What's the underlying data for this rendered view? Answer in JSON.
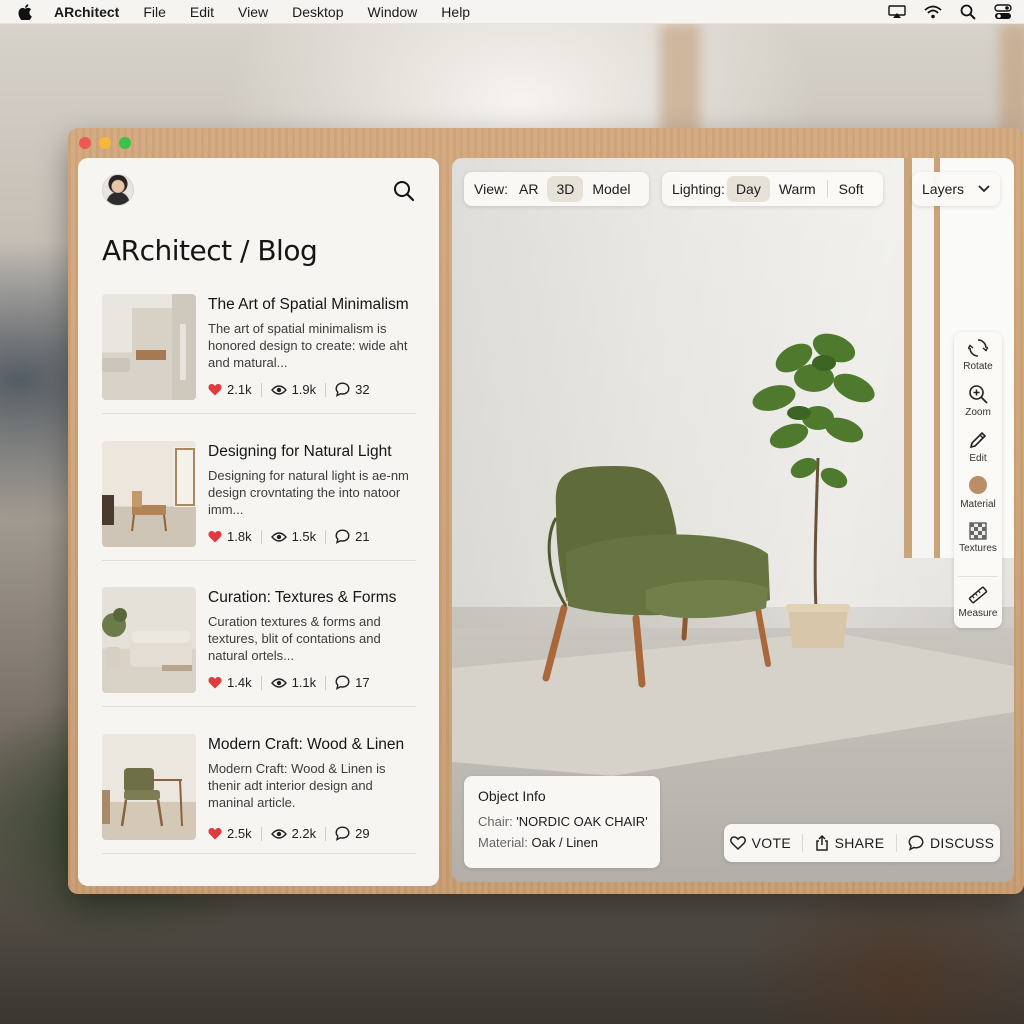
{
  "menubar": {
    "app_name": "ARchitect",
    "items": [
      "File",
      "Edit",
      "View",
      "Desktop",
      "Window",
      "Help"
    ]
  },
  "blog": {
    "title": "ARchitect / Blog",
    "posts": [
      {
        "title": "The Art of Spatial Minimalism",
        "excerpt": "The art of spatial minimalism is honored design to create: wide aht and matural...",
        "likes": "2.1k",
        "views": "1.9k",
        "comments": "32"
      },
      {
        "title": "Designing for Natural Light",
        "excerpt": "Designing for natural light is ae-nm design crovntating the into natoor imm...",
        "likes": "1.8k",
        "views": "1.5k",
        "comments": "21"
      },
      {
        "title": "Curation: Textures & Forms",
        "excerpt": "Curation textures & forms and textures, blit of contations and natural ortels...",
        "likes": "1.4k",
        "views": "1.1k",
        "comments": "17"
      },
      {
        "title": "Modern Craft: Wood & Linen",
        "excerpt": "Modern Craft: Wood & Linen is thenir adt interior design and maninal article.",
        "likes": "2.5k",
        "views": "2.2k",
        "comments": "29"
      }
    ]
  },
  "viewport": {
    "view": {
      "label": "View:",
      "options": [
        "AR",
        "3D",
        "Model"
      ],
      "selected": "3D"
    },
    "lighting": {
      "label": "Lighting:",
      "options": [
        "Day",
        "Warm",
        "Soft"
      ],
      "selected": "Day"
    },
    "layers_label": "Layers",
    "tools": [
      "Rotate",
      "Zoom",
      "Edit",
      "Material",
      "Textures",
      "Measure"
    ],
    "material_swatch_color": "#b98d65",
    "object_info": {
      "heading": "Object Info",
      "chair_label": "Chair:",
      "chair_value": "'NORDIC OAK CHAIR'",
      "material_label": "Material:",
      "material_value": "Oak / Linen"
    },
    "actions": [
      "VOTE",
      "SHARE",
      "DISCUSS"
    ]
  },
  "colors": {
    "accent_heart": "#e0393e",
    "chair_fabric": "#5f6b3a",
    "wood": "#c99b6f"
  }
}
